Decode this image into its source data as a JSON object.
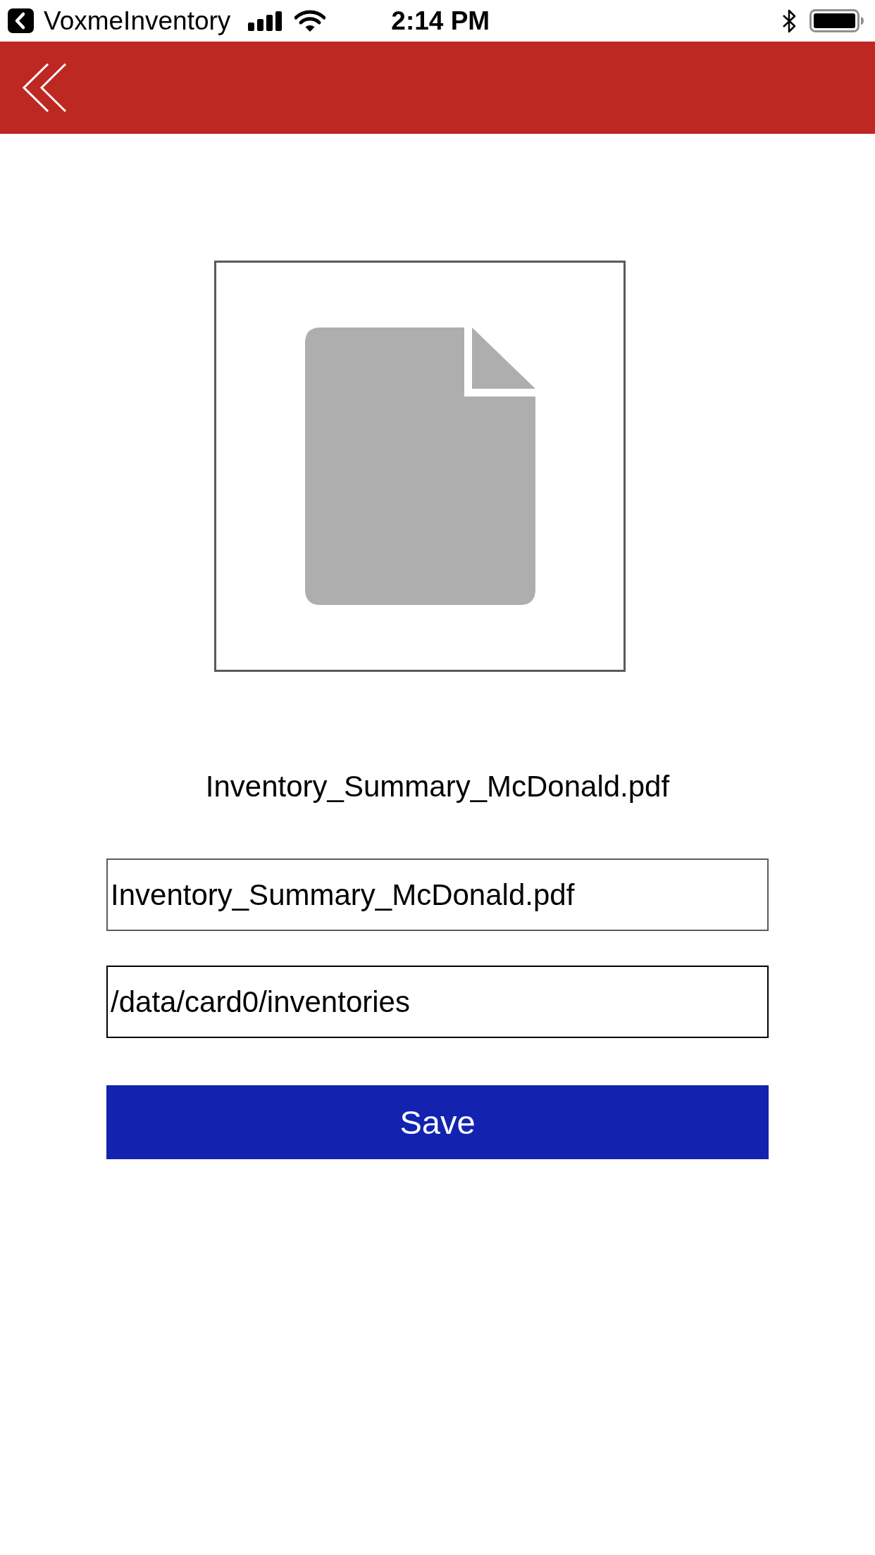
{
  "status_bar": {
    "back_app": "VoxmeInventory",
    "time": "2:14 PM"
  },
  "preview": {
    "file_name": "Inventory_Summary_McDonald.pdf"
  },
  "fields": [
    {
      "value": "Inventory_Summary_McDonald.pdf",
      "focused": false
    },
    {
      "value": "/data/card0/inventories",
      "focused": true
    }
  ],
  "save_button": {
    "label": "Save"
  }
}
